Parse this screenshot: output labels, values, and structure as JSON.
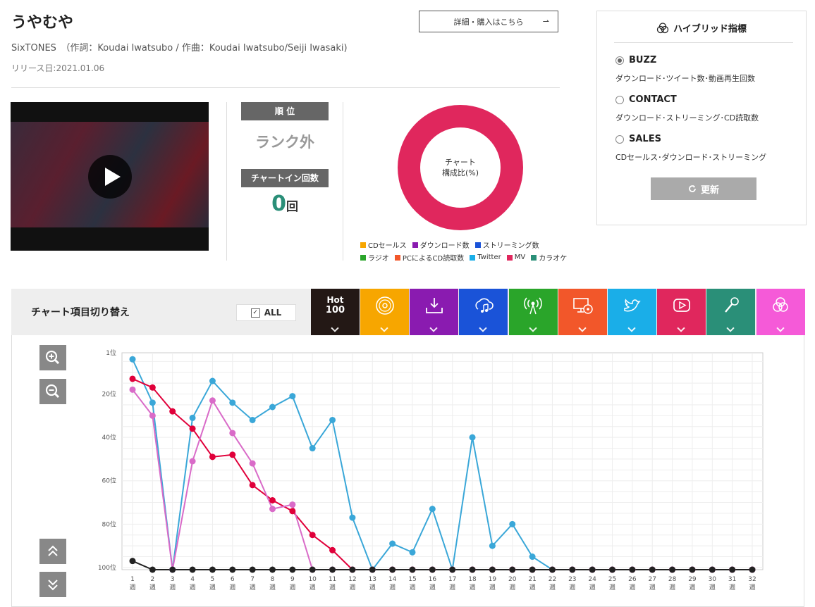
{
  "song": {
    "title": "うやむや",
    "artist_line": "SixTONES　（作詞：Koudai Iwatsubo / 作曲：Koudai Iwatsubo/Seiji Iwasaki)",
    "release": "リリース日:2021.01.06",
    "detail_button": "詳細・購入はこちら",
    "detail_arrow": "⇀"
  },
  "rank": {
    "head": "順 位",
    "value": "ランク外",
    "chartin_head": "チャートイン回数",
    "chartin_count": "0",
    "chartin_unit": "回"
  },
  "composition": {
    "label_line1": "チャート",
    "label_line2": "構成比(%)",
    "color": "#e0275d",
    "legend_row1": [
      {
        "label": "CDセールス",
        "color": "#f7a600"
      },
      {
        "label": "ダウンロード数",
        "color": "#8a1bb0"
      },
      {
        "label": "ストリーミング数",
        "color": "#1a53d8"
      }
    ],
    "legend_row2": [
      {
        "label": "ラジオ",
        "color": "#2aa52a"
      },
      {
        "label": "PCによるCD読取数",
        "color": "#f2572a"
      },
      {
        "label": "Twitter",
        "color": "#1aaee8"
      },
      {
        "label": "MV",
        "color": "#e0275d"
      },
      {
        "label": "カラオケ",
        "color": "#2a8f78"
      }
    ]
  },
  "hybrid": {
    "title": "ハイブリッド指標",
    "options": [
      {
        "label": "BUZZ",
        "desc": "ダウンロード･ツイート数･動画再生回数",
        "selected": true
      },
      {
        "label": "CONTACT",
        "desc": "ダウンロード･ストリーミング･CD読取数",
        "selected": false
      },
      {
        "label": "SALES",
        "desc": "CDセールス･ダウンロード･ストリーミング",
        "selected": false
      }
    ],
    "update_button": "更新"
  },
  "switcher": {
    "label": "チャート項目切り替え",
    "all_label": "ALL",
    "all_check": "✓",
    "hot_line1": "Hot",
    "hot_line2": "100",
    "tabs": [
      {
        "icon": "cd-icon",
        "color": "#f7a600"
      },
      {
        "icon": "download-icon",
        "color": "#8a1bb0"
      },
      {
        "icon": "streaming-icon",
        "color": "#1a53d8"
      },
      {
        "icon": "radio-icon",
        "color": "#2aa52a"
      },
      {
        "icon": "pc-cd-icon",
        "color": "#f2572a"
      },
      {
        "icon": "twitter-icon",
        "color": "#1aaee8"
      },
      {
        "icon": "video-icon",
        "color": "#e0275d"
      },
      {
        "icon": "karaoke-icon",
        "color": "#2a8f78"
      },
      {
        "icon": "hybrid-icon",
        "color": "#f55ad8"
      }
    ],
    "hot_color": "#231815"
  },
  "chart_data": {
    "type": "line",
    "x": [
      "1",
      "2",
      "3",
      "4",
      "5",
      "6",
      "7",
      "8",
      "9",
      "10",
      "11",
      "12",
      "13",
      "14",
      "15",
      "16",
      "17",
      "18",
      "19",
      "20",
      "21",
      "22",
      "23",
      "24",
      "25",
      "26",
      "27",
      "28",
      "29",
      "30",
      "31",
      "32"
    ],
    "x_unit": "週",
    "ylim": [
      1,
      101
    ],
    "y_reversed": true,
    "y_ticks": [
      1,
      20,
      40,
      60,
      80,
      100
    ],
    "y_tick_labels": [
      "1位",
      "20位",
      "40位",
      "60位",
      "80位",
      "100位"
    ],
    "grid": true,
    "series": [
      {
        "color": "#3aa7d8",
        "values": [
          4,
          24,
          101,
          31,
          14,
          24,
          32,
          26,
          21,
          45,
          32,
          77,
          101,
          89,
          93,
          73,
          101,
          40,
          90,
          80,
          95,
          101,
          101,
          101,
          101,
          101,
          101,
          101,
          101,
          101,
          101,
          101
        ]
      },
      {
        "color": "#e0003a",
        "values": [
          13,
          17,
          28,
          36,
          49,
          48,
          62,
          69,
          74,
          85,
          92,
          101,
          101,
          101,
          101,
          101,
          101,
          101,
          101,
          101,
          101,
          101,
          101,
          101,
          101,
          101,
          101,
          101,
          101,
          101,
          101,
          101
        ]
      },
      {
        "color": "#d96bc8",
        "values": [
          18,
          30,
          101,
          51,
          23,
          38,
          52,
          73,
          71,
          101,
          101,
          101,
          101,
          101,
          101,
          101,
          101,
          101,
          101,
          101,
          101,
          101,
          101,
          101,
          101,
          101,
          101,
          101,
          101,
          101,
          101,
          101
        ]
      },
      {
        "color": "#222222",
        "values": [
          97,
          101,
          101,
          101,
          101,
          101,
          101,
          101,
          101,
          101,
          101,
          101,
          101,
          101,
          101,
          101,
          101,
          101,
          101,
          101,
          101,
          101,
          101,
          101,
          101,
          101,
          101,
          101,
          101,
          101,
          101,
          101
        ]
      }
    ]
  }
}
